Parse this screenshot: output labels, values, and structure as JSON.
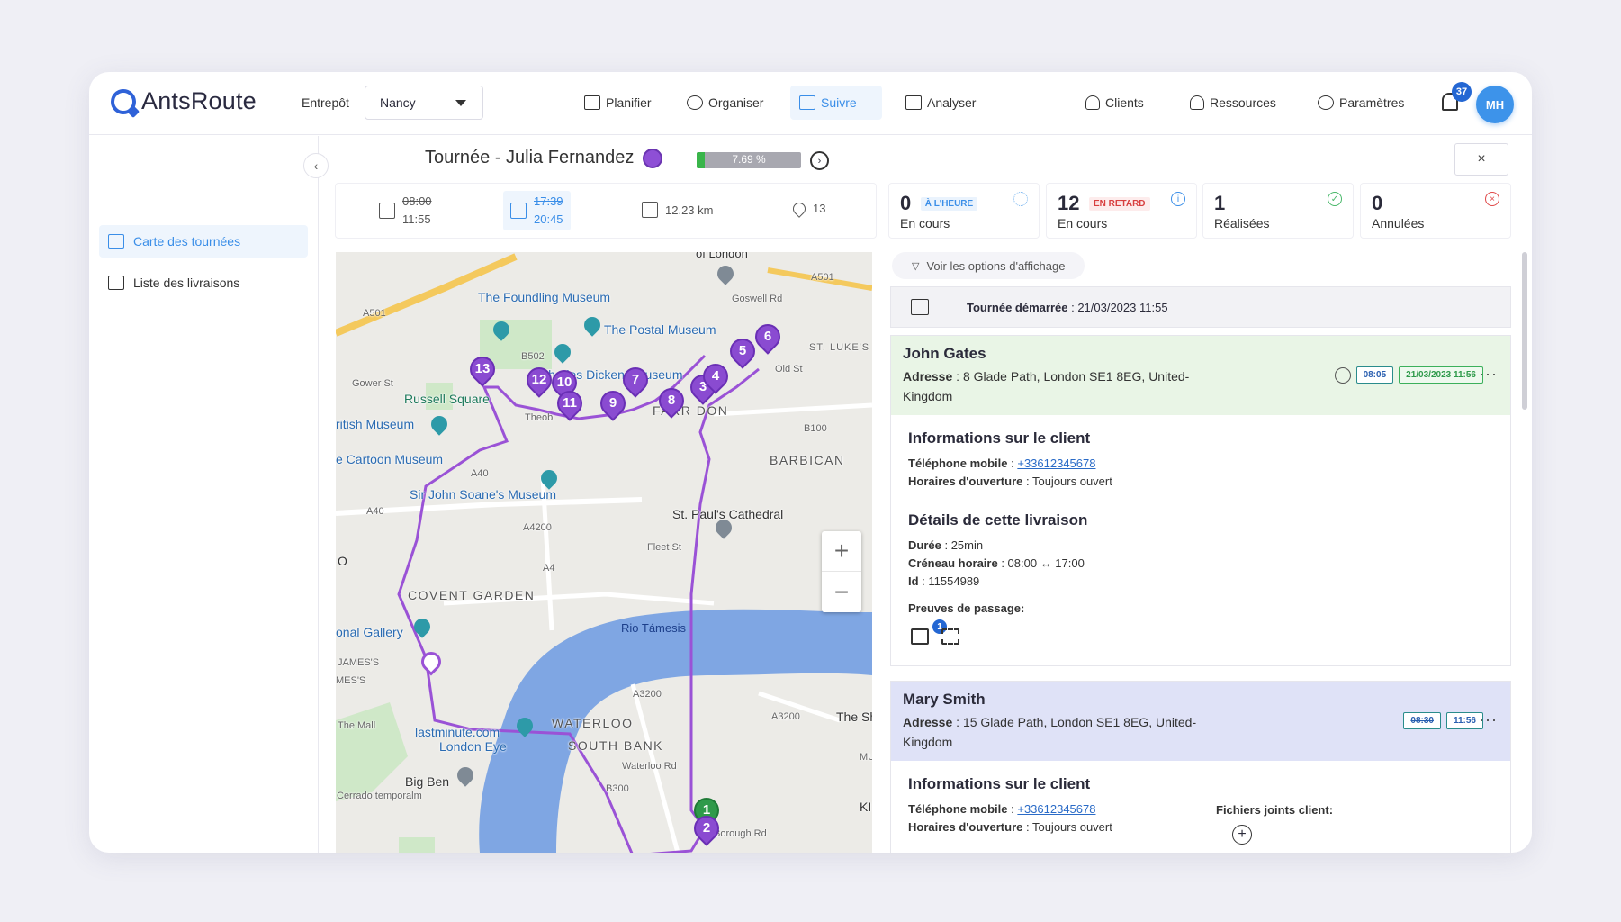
{
  "app": {
    "name": "AntsRoute"
  },
  "header": {
    "entrepot_label": "Entrepôt",
    "entrepot_value": "Nancy",
    "nav": [
      {
        "label": "Planifier",
        "icon": "calendar-icon"
      },
      {
        "label": "Organiser",
        "icon": "dashboard-icon"
      },
      {
        "label": "Suivre",
        "icon": "signpost-icon"
      },
      {
        "label": "Analyser",
        "icon": "chart-icon"
      },
      {
        "label": "Clients",
        "icon": "group-icon"
      },
      {
        "label": "Ressources",
        "icon": "person-gear-icon"
      },
      {
        "label": "Paramètres",
        "icon": "gear-icon"
      }
    ],
    "active_nav": "Suivre",
    "notif_count": "37",
    "avatar_initials": "MH"
  },
  "sidebar": {
    "items": [
      {
        "label": "Carte des tournées",
        "active": true
      },
      {
        "label": "Liste des livraisons",
        "active": false
      }
    ]
  },
  "tour": {
    "title": "Tournée - Julia Fernandez",
    "color": "#8e4fd6",
    "progress_text": "7.69 %",
    "progress_value": 7.69,
    "start_planned": "08:00",
    "start_actual": "11:55",
    "end_planned": "17:39",
    "end_actual": "20:45",
    "distance": "12.23 km",
    "stops": "13"
  },
  "status": [
    {
      "num": "0",
      "tag": "À L'HEURE",
      "label": "En cours",
      "tag_color": "#3a8ee8",
      "tag_bg": "#eaf3fd",
      "icon": "spinner-icon"
    },
    {
      "num": "12",
      "tag": "EN RETARD",
      "label": "En cours",
      "tag_color": "#d84040",
      "tag_bg": "#fdecec",
      "icon": "info-icon"
    },
    {
      "num": "1",
      "tag": "",
      "label": "Réalisées",
      "icon": "check-icon"
    },
    {
      "num": "0",
      "tag": "",
      "label": "Annulées",
      "icon": "cancel-icon"
    }
  ],
  "map": {
    "labels": {
      "foundling": "The Foundling Museum",
      "postal": "The Postal Museum",
      "dickens": "Charles Dickens Museum",
      "russell": "Russell Square",
      "british": "ritish Museum",
      "cartoon": "e Cartoon Museum",
      "soane": "Sir John Soane's Museum",
      "stpauls": "St. Paul's Cathedral",
      "covent": "COVENT GARDEN",
      "gallery": "onal Gallery",
      "james": "JAMES'S",
      "mes": "MES'S",
      "thames": "Rio Támesis",
      "waterloo": "WATERLOO",
      "southbank": "SOUTH BANK",
      "lastminute": "lastminute.com",
      "londoneye": "London Eye",
      "bigben": "Big Ben",
      "cerrado": "Cerrado temporalm",
      "barbican": "BARBICAN",
      "farringdon": "FARR     DON",
      "stlukes": "ST. LUKE'S",
      "thesh": "The Sh",
      "fleet": "Fleet St",
      "borough": "Borough Rd",
      "oflondon": "of London",
      "a501": "A501",
      "a501b": "A501",
      "a40": "A40",
      "a40b": "A40",
      "a4": "A4",
      "a3200": "A3200",
      "a3200b": "A3200",
      "b100": "B100",
      "b502": "B502",
      "oldst": "Old St",
      "gower": "Gower St",
      "goswell": "Goswell Rd",
      "themall": "The Mall",
      "waterloord": "Waterloo Rd",
      "b300": "B300",
      "a4200": "A4200",
      "theob": "Theob",
      "o": "O",
      "mu": "MU",
      "ki": "KI"
    },
    "stops": [
      {
        "n": "13"
      },
      {
        "n": "12"
      },
      {
        "n": "10"
      },
      {
        "n": "11"
      },
      {
        "n": "9"
      },
      {
        "n": "7"
      },
      {
        "n": "8"
      },
      {
        "n": "3"
      },
      {
        "n": "4"
      },
      {
        "n": "5"
      },
      {
        "n": "6"
      },
      {
        "n": "2"
      },
      {
        "n": "1"
      }
    ],
    "zoom_in": "+",
    "zoom_out": "−"
  },
  "panel": {
    "filter_label": "Voir les options d'affichage",
    "started_label": "Tournée démarrée",
    "started_value": "21/03/2023 11:55",
    "cards": [
      {
        "name": "John Gates",
        "address_label": "Adresse",
        "address": "8 Glade Path, London SE1 8EG, United-Kingdom",
        "time_planned": "08:05",
        "time_done": "21/03/2023 11:56",
        "client_title": "Informations sur le client",
        "phone_label": "Téléphone mobile",
        "phone": "+33612345678",
        "hours_label": "Horaires d'ouverture",
        "hours": "Toujours ouvert",
        "details_title": "Détails de cette livraison",
        "duration_label": "Durée",
        "duration": "25min",
        "slot_label": "Créneau horaire",
        "slot": "08:00 ↔ 17:00",
        "id_label": "Id",
        "id": "11554989",
        "proofs_label": "Preuves de passage:",
        "proofs_count": "1"
      },
      {
        "name": "Mary Smith",
        "address_label": "Adresse",
        "address": "15 Glade Path, London SE1 8EG, United-Kingdom",
        "time_planned": "08:30",
        "time_estimated": "11:56",
        "client_title": "Informations sur le client",
        "phone_label": "Téléphone mobile",
        "phone": "+33612345678",
        "hours_label": "Horaires d'ouverture",
        "hours": "Toujours ouvert",
        "files_label": "Fichiers joints client:"
      }
    ]
  }
}
